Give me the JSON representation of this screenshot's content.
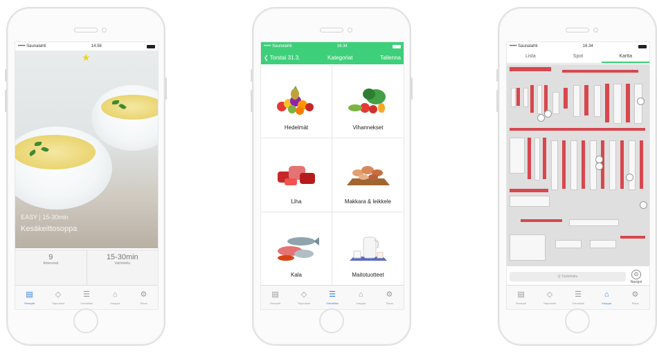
{
  "phone1": {
    "status": {
      "carrier": "••••• Saunalahti",
      "time": "14.58"
    },
    "overlay": {
      "line1": "EASY | 15-30min",
      "line2": "Kesäkeittosoppa"
    },
    "info": [
      {
        "value": "9",
        "label": "Ainesosat"
      },
      {
        "value": "15-30min",
        "label": "Valmistelu"
      }
    ],
    "active_tab": 0
  },
  "phone2": {
    "status": {
      "carrier": "••••• Saunalahti",
      "time": "16.34"
    },
    "nav": {
      "back": "Torstai 31.3.",
      "title": "Kategoriat",
      "action": "Tallenna"
    },
    "categories": [
      {
        "name": "Hedelmät",
        "icon": "fruit-icon"
      },
      {
        "name": "Vihannekset",
        "icon": "vegetable-icon"
      },
      {
        "name": "Liha",
        "icon": "meat-icon"
      },
      {
        "name": "Makkara & leikkele",
        "icon": "sausage-icon"
      },
      {
        "name": "Kala",
        "icon": "fish-icon"
      },
      {
        "name": "Maitotuotteet",
        "icon": "dairy-icon"
      }
    ],
    "active_tab": 2
  },
  "phone3": {
    "status": {
      "carrier": "••••• Saunalahti",
      "time": "16.34"
    },
    "segments": [
      "Lista",
      "Spot",
      "Kartta"
    ],
    "active_segment": 2,
    "search_placeholder": "Q Tuotehaku",
    "navig_label": "Navigoi",
    "active_tab": 3
  },
  "tabs": [
    {
      "label": "Reseptit",
      "icon": "recipe-icon"
    },
    {
      "label": "Tarjoukset",
      "icon": "tag-icon"
    },
    {
      "label": "Ostoslista",
      "icon": "list-icon"
    },
    {
      "label": "Kauppa",
      "icon": "store-icon"
    },
    {
      "label": "Tilaus",
      "icon": "gear-icon"
    }
  ],
  "colors": {
    "green": "#3ecf7a",
    "active_tab": "#2f7fe8",
    "star": "#f3d21b",
    "shelf_red": "#d7474d"
  }
}
